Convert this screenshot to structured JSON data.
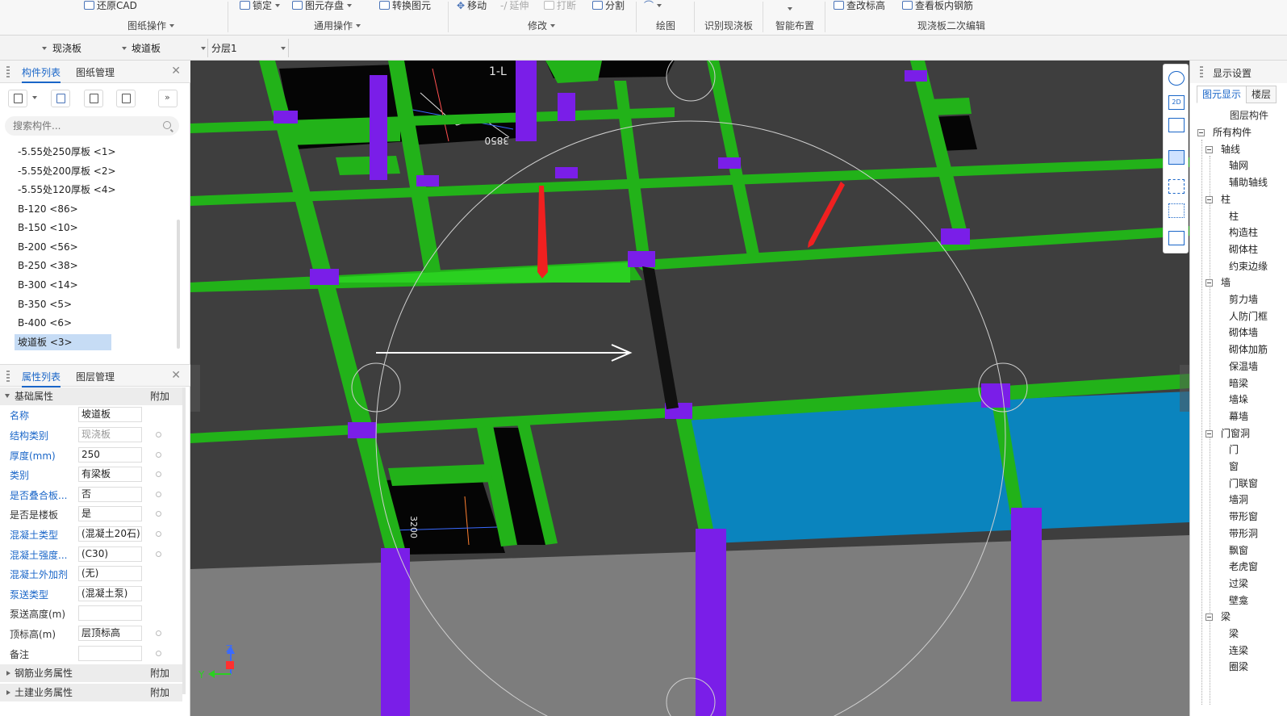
{
  "ribbon": {
    "tools": {
      "restore_cad": "还原CAD",
      "lock": "锁定",
      "save_element": "图元存盘",
      "convert_element": "转换图元",
      "move": "移动",
      "extend": "延伸",
      "break": "打断",
      "split": "分割",
      "modify_elevation": "查改标高",
      "view_slab_rebar": "查看板内钢筋"
    },
    "groups": {
      "drawing_ops": "图纸操作",
      "common_ops": "通用操作",
      "modify": "修改",
      "draw": "绘图",
      "identify_slab": "识别现浇板",
      "smart_layout": "智能布置",
      "slab_edit": "现浇板二次编辑"
    }
  },
  "selectors": {
    "s1": "现浇板",
    "s2": "坡道板",
    "s3": "分层1"
  },
  "component_panel": {
    "tabs": [
      "构件列表",
      "图纸管理"
    ],
    "search_placeholder": "搜索构件...",
    "items": [
      "-5.55处250厚板 <1>",
      "-5.55处200厚板 <2>",
      "-5.55处120厚板 <4>",
      "B-120 <86>",
      "B-150 <10>",
      "B-200 <56>",
      "B-250 <38>",
      "B-300 <14>",
      "B-350 <5>",
      "B-400 <6>",
      "坡道板 <3>"
    ]
  },
  "property_panel": {
    "tabs": [
      "属性列表",
      "图层管理"
    ],
    "basic_section": "基础属性",
    "append_label": "附加",
    "rows": [
      {
        "k": "名称",
        "v": "坡道板"
      },
      {
        "k": "结构类别",
        "v": "现浇板"
      },
      {
        "k": "厚度(mm)",
        "v": "250"
      },
      {
        "k": "类别",
        "v": "有梁板"
      },
      {
        "k": "是否叠合板...",
        "v": "否"
      },
      {
        "k": "是否是楼板",
        "v": "是"
      },
      {
        "k": "混凝土类型",
        "v": "(混凝土20石)"
      },
      {
        "k": "混凝土强度...",
        "v": "(C30)"
      },
      {
        "k": "混凝土外加剂",
        "v": "(无)"
      },
      {
        "k": "泵送类型",
        "v": "(混凝土泵)"
      },
      {
        "k": "泵送高度(m)",
        "v": ""
      },
      {
        "k": "顶标高(m)",
        "v": "层顶标高"
      },
      {
        "k": "备注",
        "v": ""
      }
    ],
    "rebar_section": "钢筋业务属性",
    "civil_section": "土建业务属性"
  },
  "viewport": {
    "axis_label": "1-L",
    "dim_label_1": "3850",
    "dim_label_2": "3200",
    "axis_z": "Z",
    "axis_y": "Y",
    "colors": {
      "beam": "#2aa01c",
      "column": "#7a1ee8",
      "slab": "#4a4a4a",
      "selected": "#0a84be",
      "wall": "#808080"
    }
  },
  "display_panel": {
    "title": "显示设置",
    "tabs": [
      "图元显示",
      "楼层"
    ],
    "header": "图层构件",
    "tree": [
      {
        "t": "所有构件",
        "lvl": 0,
        "box": true
      },
      {
        "t": "轴线",
        "lvl": 1,
        "box": true
      },
      {
        "t": "轴网",
        "lvl": 2
      },
      {
        "t": "辅助轴线",
        "lvl": 2
      },
      {
        "t": "柱",
        "lvl": 1,
        "box": true
      },
      {
        "t": "柱",
        "lvl": 2
      },
      {
        "t": "构造柱",
        "lvl": 2
      },
      {
        "t": "砌体柱",
        "lvl": 2
      },
      {
        "t": "约束边缘",
        "lvl": 2
      },
      {
        "t": "墙",
        "lvl": 1,
        "box": true
      },
      {
        "t": "剪力墙",
        "lvl": 2
      },
      {
        "t": "人防门框",
        "lvl": 2
      },
      {
        "t": "砌体墙",
        "lvl": 2
      },
      {
        "t": "砌体加筋",
        "lvl": 2
      },
      {
        "t": "保温墙",
        "lvl": 2
      },
      {
        "t": "暗梁",
        "lvl": 2
      },
      {
        "t": "墙垛",
        "lvl": 2
      },
      {
        "t": "幕墙",
        "lvl": 2
      },
      {
        "t": "门窗洞",
        "lvl": 1,
        "box": true
      },
      {
        "t": "门",
        "lvl": 2
      },
      {
        "t": "窗",
        "lvl": 2
      },
      {
        "t": "门联窗",
        "lvl": 2
      },
      {
        "t": "墙洞",
        "lvl": 2
      },
      {
        "t": "带形窗",
        "lvl": 2
      },
      {
        "t": "带形洞",
        "lvl": 2
      },
      {
        "t": "飘窗",
        "lvl": 2
      },
      {
        "t": "老虎窗",
        "lvl": 2
      },
      {
        "t": "过梁",
        "lvl": 2
      },
      {
        "t": "壁龛",
        "lvl": 2
      },
      {
        "t": "梁",
        "lvl": 1,
        "box": true
      },
      {
        "t": "梁",
        "lvl": 2
      },
      {
        "t": "连梁",
        "lvl": 2
      },
      {
        "t": "圈梁",
        "lvl": 2
      }
    ]
  }
}
